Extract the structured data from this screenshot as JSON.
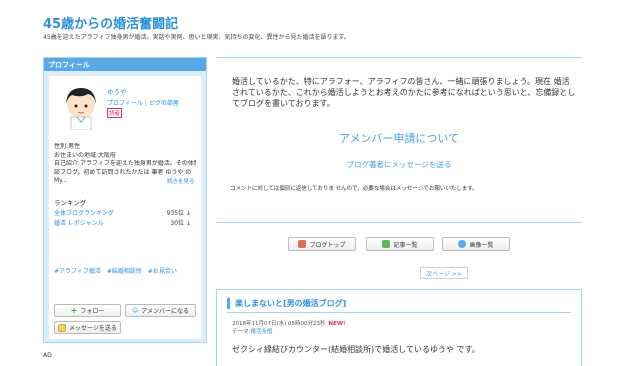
{
  "blog": {
    "title": "45歳からの婚活奮闘記",
    "description": "45歳を迎えたアラフィフ独身男が婚活。実話や実例、思いと現実、気持ちの変化、異性から見た婚活を語ります。"
  },
  "sidebar": {
    "header": "プロフィール",
    "nickname": "ゆうや",
    "profile_link": "プロフィール",
    "room_link": "ピグの部屋",
    "read_badge": "読者",
    "gender": "性別:男性",
    "location": "お住まいの地域:大阪府",
    "intro_line1": "自己紹介:アラフィフを迎えた独身男が婚活。その体験",
    "intro_line2": "談ブログ。初めて訪問されたかたは 筆者 ゆうや の",
    "intro_line3": "My...",
    "more_link": "続きを見る",
    "ranking_title": "ランキング",
    "rankings": [
      {
        "label": "全体ブログランキング",
        "value": "935位 ↓"
      },
      {
        "label": "婚活 レポジャンル",
        "value": "30位 ↓"
      }
    ],
    "tags": [
      "#アラフィフ婚活",
      "#結婚相談所",
      "#お見合い"
    ],
    "follow_button": "フォロー",
    "amember_button": "アメンバーになる",
    "message_button": "メッセージを送る"
  },
  "ad_label": "AD",
  "main": {
    "intro": "婚活しているかた、特にアラフォー、アラフィフの皆さん、一緒に頑張りましょう。現在 婚活されているかた、これから婚活しようとお考えのかたに参考になればという思いと、忘備録としてブログを書いております。",
    "member_title": "アメンバー申請について",
    "message_link": "ブログ著者にメッセージを送る",
    "comment_note": "コメントに対しては個別に返信しておりま せんので、必要な場合はメッセージでお願いいたします。",
    "nav_top": "ブログトップ",
    "nav_list": "記事一覧",
    "nav_images": "画像一覧",
    "next_button": "次ページ >>"
  },
  "article": {
    "title": "楽しまないと[男の婚活ブログ]",
    "date": "2018年11月07日(水) 05時00分23秒",
    "new_badge": "NEW!",
    "theme_label": "テーマ:",
    "theme": "婚活全般",
    "body": "ゼクシィ縁結びカウンター(結婚相談所)で婚活しているゆうや です。"
  },
  "colors": {
    "accent": "#2e8fd9",
    "sidebar_bg": "#dceefb",
    "header_bg": "#5aa9e6",
    "new_badge": "#e03060"
  }
}
